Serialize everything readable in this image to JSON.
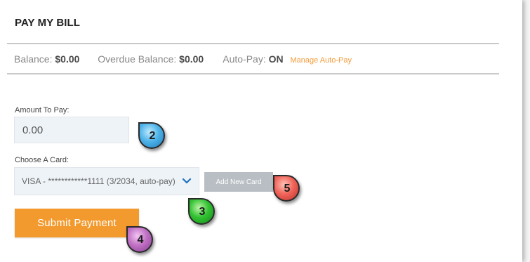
{
  "header": {
    "title": "PAY MY BILL"
  },
  "balances": {
    "balance_label": "Balance:",
    "balance_value": "$0.00",
    "overdue_label": "Overdue Balance:",
    "overdue_value": "$0.00",
    "autopay_label": "Auto-Pay:",
    "autopay_value": "ON",
    "manage_link": "Manage Auto-Pay"
  },
  "form": {
    "amount_label": "Amount To Pay:",
    "amount_value": "0.00",
    "card_label": "Choose A Card:",
    "card_selected": "VISA - ************1111 (3/2034, auto-pay)",
    "add_card_label": "Add New Card",
    "submit_label": "Submit Payment"
  },
  "badges": [
    {
      "number": "2",
      "color": "#4fb3e8"
    },
    {
      "number": "3",
      "color": "#33c233"
    },
    {
      "number": "4",
      "color": "#c071c4"
    },
    {
      "number": "5",
      "color": "#f0645a"
    }
  ],
  "colors": {
    "accent_orange": "#f29a2e",
    "link_orange": "#f39c3a",
    "input_bg": "#eef3f7",
    "chevron_blue": "#1e73be"
  }
}
